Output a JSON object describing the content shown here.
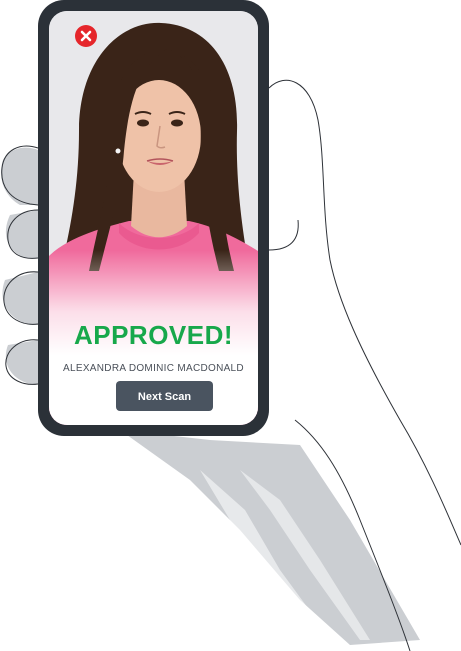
{
  "verification": {
    "status_text": "APPROVED!",
    "subject_name": "ALEXANDRA DOMINIC MACDONALD",
    "next_button_label": "Next Scan",
    "status_color": "#17a84b"
  },
  "icons": {
    "close": "close-icon"
  },
  "colors": {
    "close_button": "#e5262b",
    "phone_frame": "#2b3138",
    "next_button": "#4a5460"
  }
}
